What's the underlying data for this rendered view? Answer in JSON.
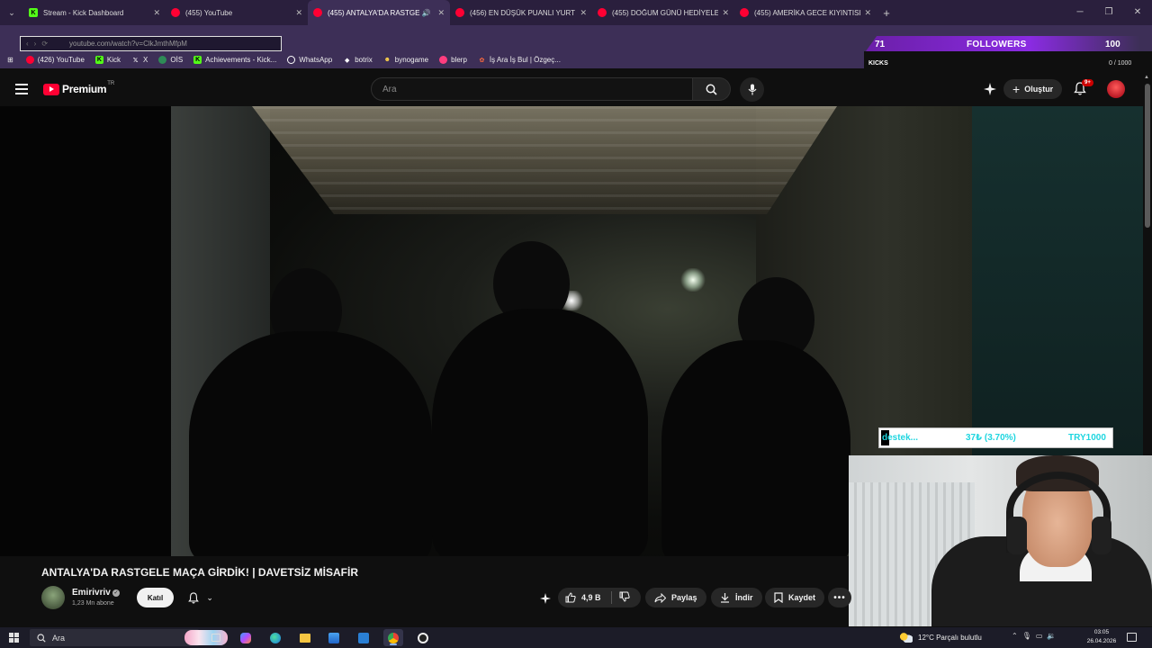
{
  "browser": {
    "tabs": [
      {
        "title": "Stream - Kick Dashboard",
        "favicon": "kick",
        "active": false
      },
      {
        "title": "(455) YouTube",
        "favicon": "yt",
        "active": false
      },
      {
        "title": "(455) ANTALYA'DA RASTGE",
        "favicon": "yt",
        "active": true
      },
      {
        "title": "(456) EN DÜŞÜK PUANLI YURT",
        "favicon": "yt",
        "active": false
      },
      {
        "title": "(455) DOĞUM GÜNÜ HEDİYELE",
        "favicon": "yt",
        "active": false
      },
      {
        "title": "(455) AMERİKA GECE KIYINTISI",
        "favicon": "yt",
        "active": false
      }
    ],
    "new_tab": "+",
    "url": "youtube.com/watch?v=ClkJmthMfpM",
    "bookmarks": [
      {
        "label": "(426) YouTube",
        "icon": "yt"
      },
      {
        "label": "Kick",
        "icon": "kick"
      },
      {
        "label": "X",
        "icon": "x"
      },
      {
        "label": "OİS",
        "icon": "ois"
      },
      {
        "label": "Achievements - Kick...",
        "icon": "kick"
      },
      {
        "label": "WhatsApp",
        "icon": "whatsapp"
      },
      {
        "label": "botrix",
        "icon": "botrix"
      },
      {
        "label": "bynogame",
        "icon": "bynogame"
      },
      {
        "label": "blerp",
        "icon": "blerp"
      },
      {
        "label": "İş Ara İş Bul | Özgeç...",
        "icon": "job"
      }
    ]
  },
  "kick_overlay": {
    "followers_count": "71",
    "followers_label": "FOLLOWERS",
    "followers_goal": "100",
    "kicks_label": "KICKS",
    "kicks_value": "0 / 1000",
    "accent": "#8a2be2"
  },
  "youtube": {
    "logo_text": "Premium",
    "logo_sup": "TR",
    "search_placeholder": "Ara",
    "create_label": "Oluştur",
    "notif_count": "9+",
    "video": {
      "title": "ANTALYA'DA RASTGELE MAÇA GİRDİK! | DAVETSİZ MİSAFİR",
      "channel": "Emirivriv",
      "subscribers": "1,23 Mn abone",
      "join_label": "Katıl",
      "likes": "4,9 B",
      "share_label": "Paylaş",
      "download_label": "İndir",
      "save_label": "Kaydet"
    }
  },
  "donation": {
    "text": "destek...",
    "percent": "37₺ (3.70%)",
    "goal": "TRY1000",
    "progress_fraction": 0.037
  },
  "taskbar": {
    "search_label": "Ara",
    "weather": "12°C Parçalı bulutlu",
    "time": "03:05",
    "date": "26.04.2026"
  }
}
